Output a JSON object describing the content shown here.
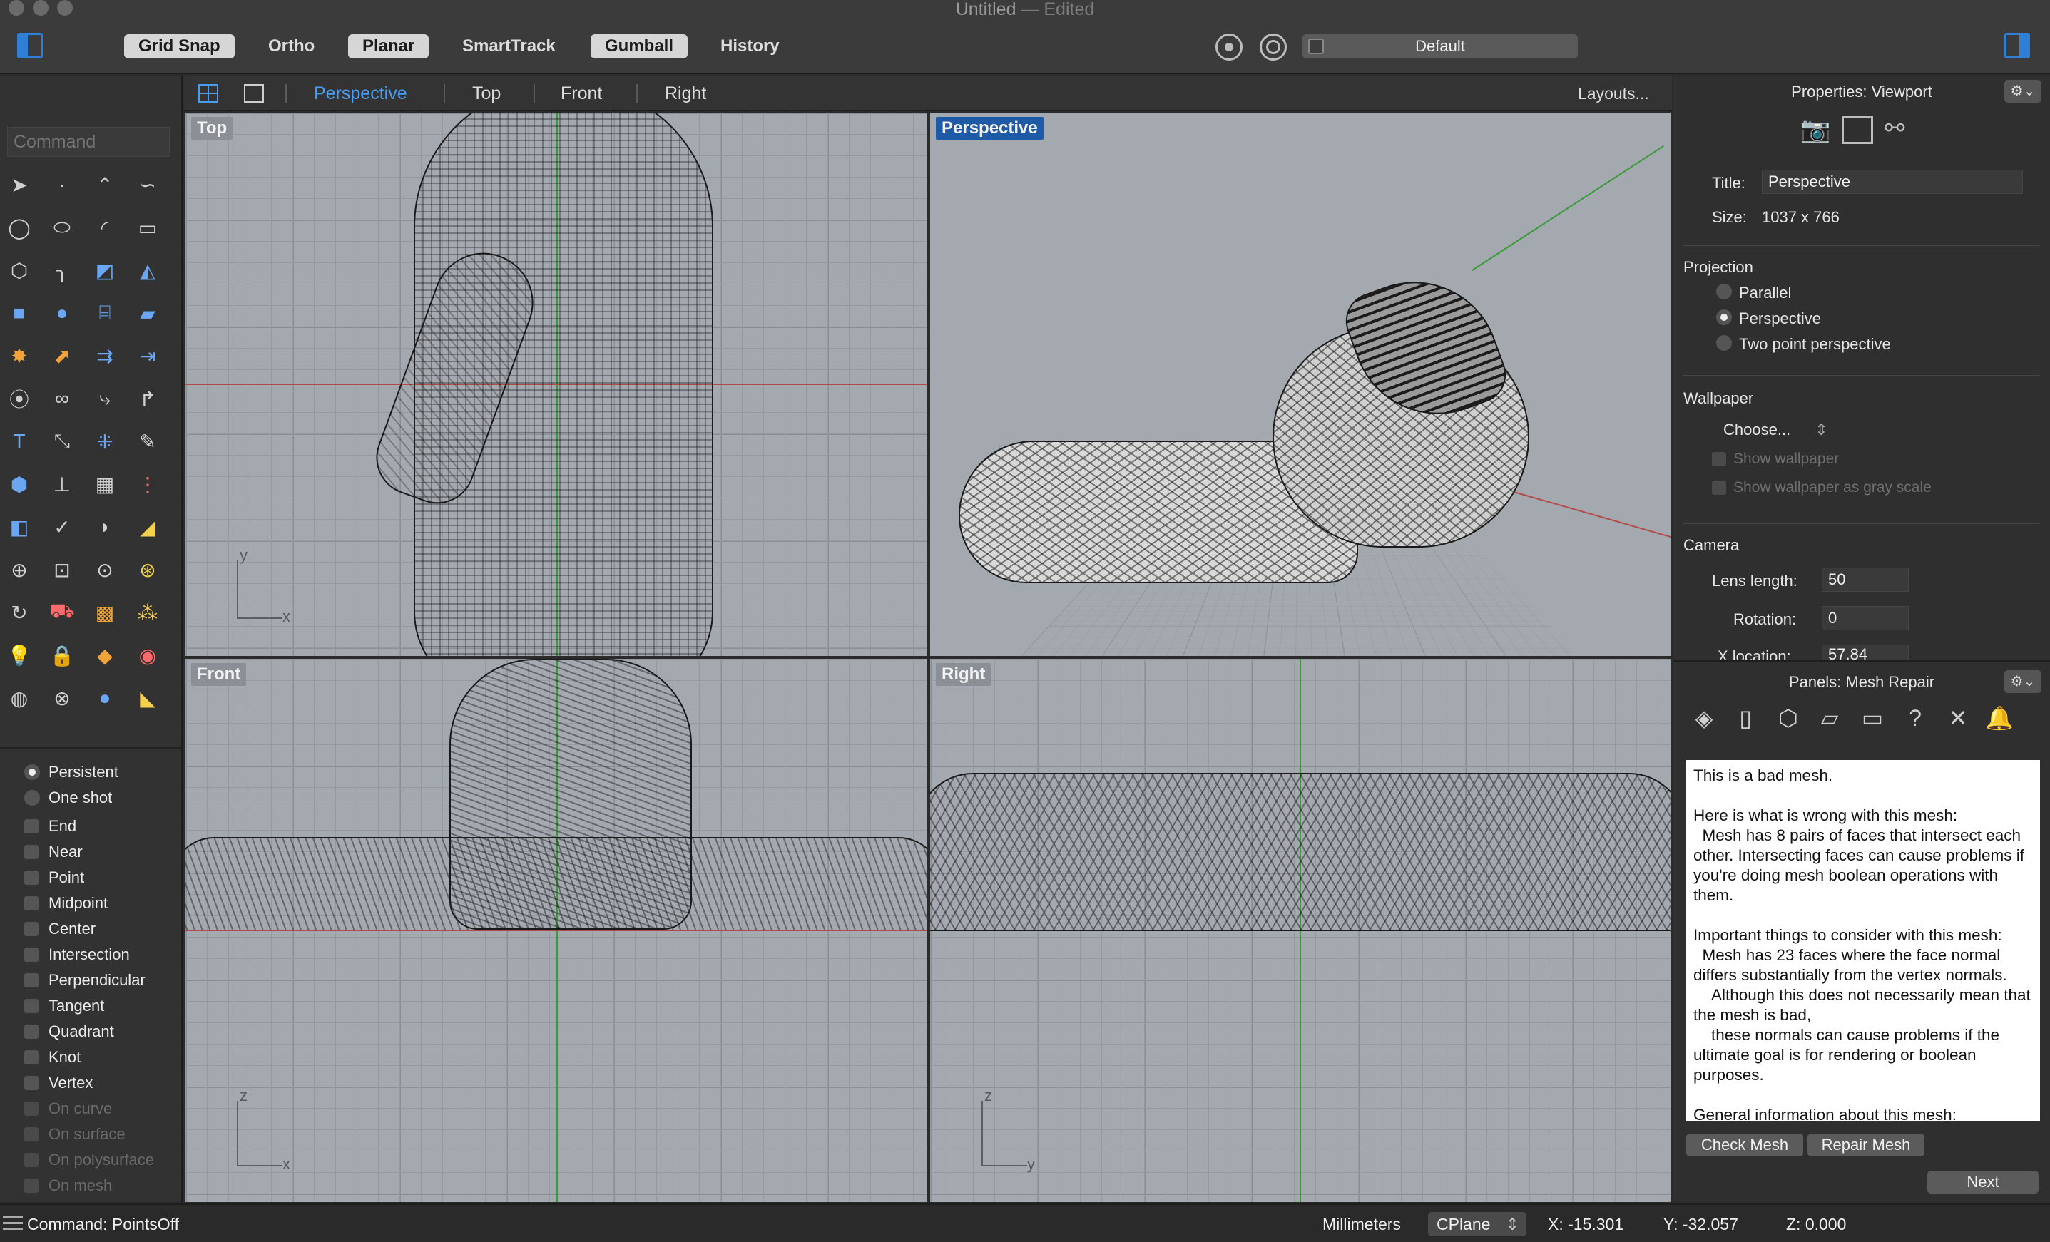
{
  "window": {
    "title": "Untitled",
    "title_suffix": "— Edited"
  },
  "toolbar": {
    "buttons": [
      {
        "label": "Grid Snap",
        "on": true
      },
      {
        "label": "Ortho",
        "on": false
      },
      {
        "label": "Planar",
        "on": true
      },
      {
        "label": "SmartTrack",
        "on": false
      },
      {
        "label": "Gumball",
        "on": true
      },
      {
        "label": "History",
        "on": false
      }
    ],
    "display_mode": "Default"
  },
  "command": {
    "placeholder": "Command"
  },
  "snaps": {
    "modes": [
      {
        "label": "Persistent",
        "selected": true
      },
      {
        "label": "One shot",
        "selected": false
      }
    ],
    "osnaps": [
      {
        "label": "End",
        "enabled": true
      },
      {
        "label": "Near",
        "enabled": true
      },
      {
        "label": "Point",
        "enabled": true
      },
      {
        "label": "Midpoint",
        "enabled": true
      },
      {
        "label": "Center",
        "enabled": true
      },
      {
        "label": "Intersection",
        "enabled": true
      },
      {
        "label": "Perpendicular",
        "enabled": true
      },
      {
        "label": "Tangent",
        "enabled": true
      },
      {
        "label": "Quadrant",
        "enabled": true
      },
      {
        "label": "Knot",
        "enabled": true
      },
      {
        "label": "Vertex",
        "enabled": true
      },
      {
        "label": "On curve",
        "enabled": false
      },
      {
        "label": "On surface",
        "enabled": false
      },
      {
        "label": "On polysurface",
        "enabled": false
      },
      {
        "label": "On mesh",
        "enabled": false
      }
    ]
  },
  "viewport_tabs": {
    "tabs": [
      "Perspective",
      "Top",
      "Front",
      "Right"
    ],
    "active": "Perspective",
    "layouts": "Layouts..."
  },
  "viewports": {
    "top": {
      "label": "Top",
      "axis_v": "y",
      "axis_h": "x"
    },
    "perspective": {
      "label": "Perspective"
    },
    "front": {
      "label": "Front",
      "axis_v": "z",
      "axis_h": "x"
    },
    "right": {
      "label": "Right",
      "axis_v": "z",
      "axis_h": "y"
    }
  },
  "properties": {
    "title": "Properties: Viewport",
    "gear": "⚙⌄",
    "title_label": "Title:",
    "title_value": "Perspective",
    "size_label": "Size:",
    "size_value": "1037 x 766",
    "projection": {
      "heading": "Projection",
      "options": [
        {
          "label": "Parallel",
          "selected": false
        },
        {
          "label": "Perspective",
          "selected": true
        },
        {
          "label": "Two point perspective",
          "selected": false
        }
      ]
    },
    "wallpaper": {
      "heading": "Wallpaper",
      "choose": "Choose...",
      "show": "Show wallpaper",
      "gray": "Show wallpaper as gray scale"
    },
    "camera": {
      "heading": "Camera",
      "lens_label": "Lens length:",
      "lens_value": "50",
      "rotation_label": "Rotation:",
      "rotation_value": "0",
      "xloc_label": "X location:",
      "xloc_value": "57.84"
    }
  },
  "panels": {
    "title": "Panels: Mesh Repair",
    "gear": "⚙⌄",
    "icons": [
      "layers-icon",
      "document-icon",
      "cube-icon",
      "clipboard-icon",
      "display-icon",
      "help-icon",
      "tools-icon",
      "bell-icon"
    ],
    "report": "This is a bad mesh.\n\nHere is what is wrong with this mesh:\n  Mesh has 8 pairs of faces that intersect each other. Intersecting faces can cause problems if you're doing mesh boolean operations with them.\n\nImportant things to consider with this mesh:\n  Mesh has 23 faces where the face normal differs substantially from the vertex normals.\n    Although this does not necessarily mean that the mesh is bad,\n    these normals can cause problems if the ultimate goal is for rendering or boolean purposes.\n\nGeneral information about this mesh:",
    "check_button": "Check Mesh",
    "repair_button": "Repair Mesh",
    "next_button": "Next"
  },
  "status": {
    "command_text": "Command: PointsOff",
    "units": "Millimeters",
    "cplane": "CPlane",
    "x": "X: -15.301",
    "y": "Y: -32.057",
    "z": "Z: 0.000"
  },
  "colors": {
    "accent": "#2f7fd6",
    "viewport_bg": "#a4a9b0",
    "active_label": "#1d5aa8"
  }
}
